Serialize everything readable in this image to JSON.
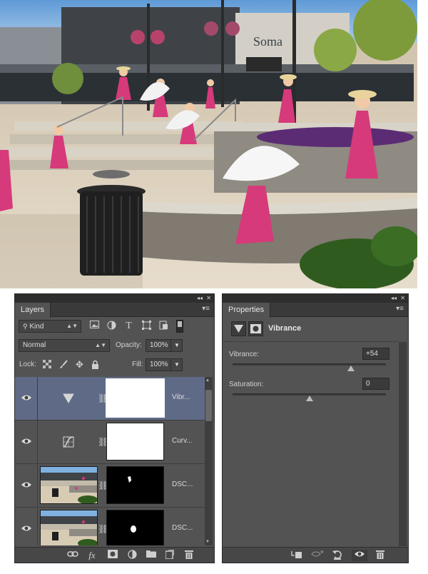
{
  "layers_panel": {
    "tab_label": "Layers",
    "collapse_glyph": "◂◂",
    "close_glyph": "✕",
    "menu_glyph": "▾≡",
    "kind_filter": {
      "value": "Kind",
      "search_icon": "search-icon"
    },
    "filter_icons": [
      "image-filter-icon",
      "adjustment-filter-icon",
      "text-filter-icon",
      "shape-filter-icon",
      "smart-object-filter-icon",
      "filter-toggle"
    ],
    "blend_mode": "Normal",
    "opacity_label": "Opacity:",
    "opacity_value": "100%",
    "lock_label": "Lock:",
    "fill_label": "Fill:",
    "fill_value": "100%",
    "layers": [
      {
        "name": "Vibr...",
        "kind": "vibrance-adjustment",
        "visible": true,
        "selected": true
      },
      {
        "name": "Curv...",
        "kind": "curves-adjustment",
        "visible": true,
        "selected": false
      },
      {
        "name": "DSC...",
        "kind": "photo-layer",
        "visible": true,
        "selected": false
      },
      {
        "name": "DSC...",
        "kind": "photo-layer",
        "visible": true,
        "selected": false
      }
    ],
    "bottom_icons": [
      "link-icon",
      "fx-icon",
      "add-mask-icon",
      "adjustment-layer-icon",
      "group-folder-icon",
      "new-layer-icon",
      "trash-icon"
    ],
    "fx_label": "fx"
  },
  "properties_panel": {
    "tab_label": "Properties",
    "collapse_glyph": "◂◂",
    "close_glyph": "✕",
    "menu_glyph": "▾≡",
    "title": "Vibrance",
    "vibrance_label": "Vibrance:",
    "vibrance_value": "+54",
    "vibrance_level": 0.77,
    "saturation_label": "Saturation:",
    "saturation_value": "0",
    "saturation_level": 0.5,
    "bottom_icons": [
      "clip-to-layer-icon",
      "view-previous-state-icon",
      "reset-icon",
      "visibility-eye-icon",
      "trash-icon"
    ]
  },
  "photo": {
    "sign_text": "Soma"
  },
  "colors": {
    "panel_bg": "#535353",
    "selected_row": "#5f6b86",
    "dress_pink": "#d63a7a",
    "sky": "#7fb1e0"
  }
}
